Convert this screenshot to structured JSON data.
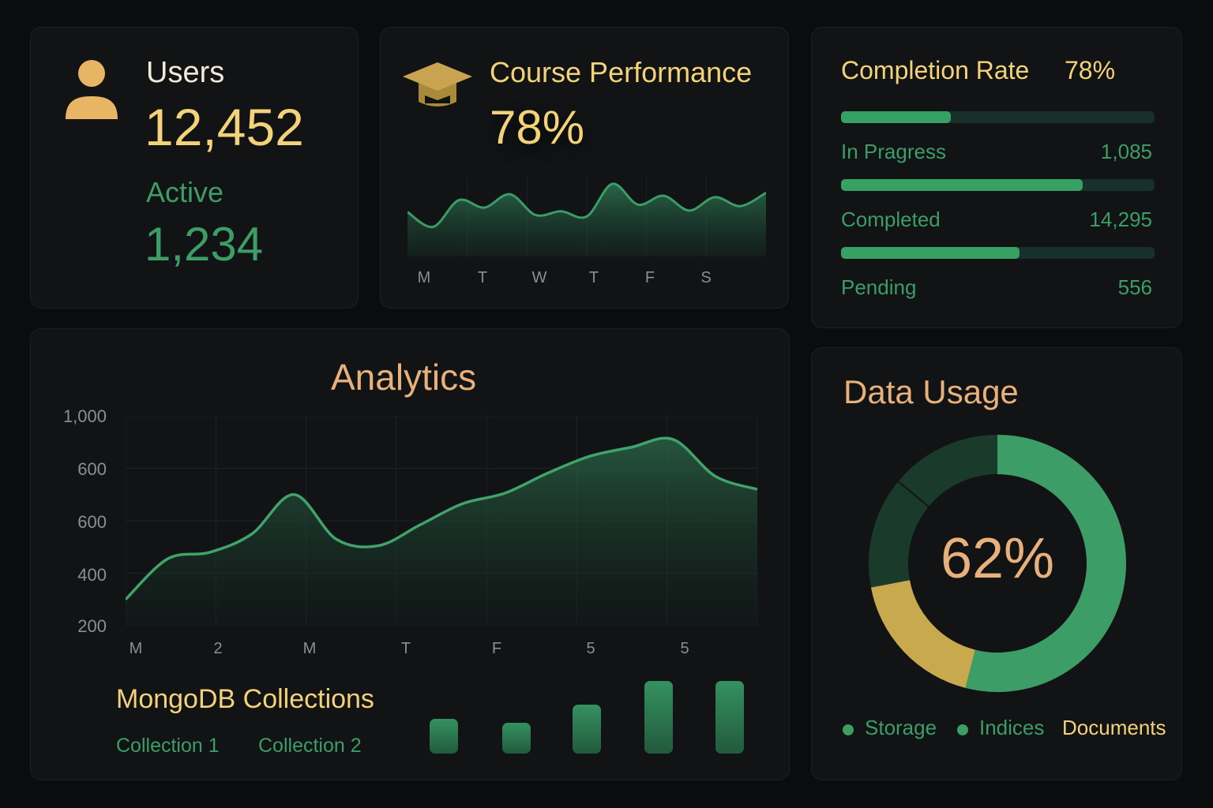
{
  "colors": {
    "background": "#0b0c0d",
    "card": "#111315",
    "gold": "#f3d27a",
    "green": "#3c9d66",
    "peach": "#e8b07a",
    "bar_track": "#18302a",
    "donut_dark": "#1a3a2c",
    "donut_yellow": "#c9a94e"
  },
  "users": {
    "icon": "user-icon",
    "title": "Users",
    "count": "12,452",
    "active_label": "Active",
    "active_count": "1,234"
  },
  "course": {
    "icon": "graduation-cap-icon",
    "title": "Course Performance",
    "percent": "78%",
    "days": [
      "M",
      "T",
      "W",
      "T",
      "F",
      "S"
    ],
    "trend": [
      0.62,
      0.42,
      0.78,
      0.68,
      0.86,
      0.58,
      0.63,
      0.56,
      1.0,
      0.72,
      0.84,
      0.64,
      0.82,
      0.7,
      0.88
    ]
  },
  "completion": {
    "title": "Completion Rate",
    "rate": "78%",
    "rows": [
      {
        "label": "In Prаgress",
        "value": "1,085"
      },
      {
        "label": "Completed",
        "value": "14,295"
      },
      {
        "label": "Pending",
        "value": "556"
      }
    ],
    "bars": [
      0.35,
      0.77,
      0.57
    ]
  },
  "analytics": {
    "title": "Analytics",
    "y_ticks": [
      "1,000",
      "600",
      "600",
      "400",
      "200"
    ],
    "x_ticks": [
      "M",
      "2",
      "M",
      "T",
      "F",
      "5",
      "5"
    ],
    "chart_data": {
      "type": "area",
      "x": [
        "M",
        "2",
        "M",
        "T",
        "F",
        "5",
        "5"
      ],
      "values": [
        300,
        455,
        480,
        550,
        700,
        530,
        505,
        585,
        665,
        705,
        780,
        845,
        880,
        910,
        770,
        720
      ],
      "ylim": [
        200,
        1000
      ],
      "grid": true
    },
    "mongo_title": "MongoDB Collections",
    "collections": [
      "Collection 1",
      "Collection 2"
    ],
    "collection_bars": [
      0.48,
      0.42,
      0.67,
      1.0,
      1.0
    ]
  },
  "usage": {
    "title": "Data Usage",
    "percent": "62%",
    "legend": [
      "Storage",
      "Indices",
      "Documents"
    ],
    "segments": [
      0.54,
      0.18,
      0.28
    ]
  }
}
